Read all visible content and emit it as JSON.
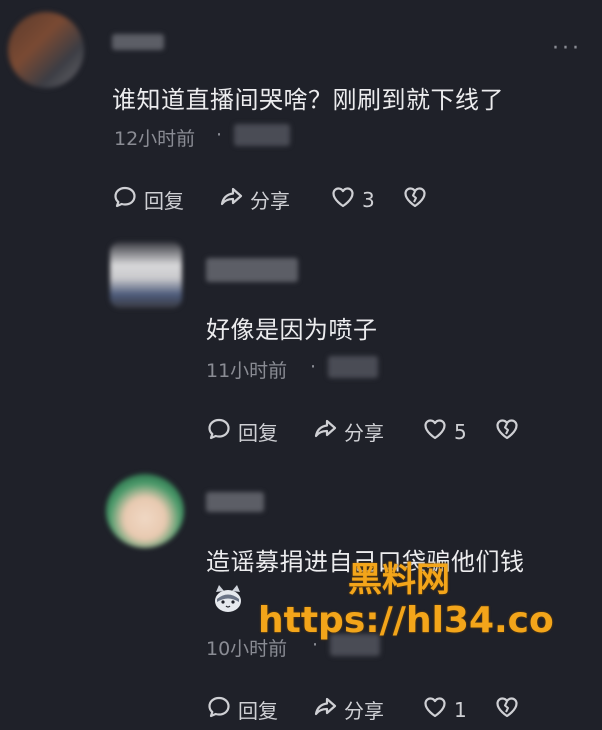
{
  "comments": [
    {
      "text": "谁知道直播间哭啥？刚刷到就下线了",
      "time": "12小时前",
      "sep": "·",
      "actions": {
        "reply": "回复",
        "share": "分享",
        "likes": "3"
      }
    },
    {
      "text": "好像是因为喷子",
      "time": "11小时前",
      "sep": "·",
      "actions": {
        "reply": "回复",
        "share": "分享",
        "likes": "5"
      }
    },
    {
      "text": "造谣募捐进自己口袋骗他们钱",
      "time": "10小时前",
      "sep": "·",
      "actions": {
        "reply": "回复",
        "share": "分享",
        "likes": "1"
      }
    }
  ],
  "more_glyph": "···",
  "watermark": {
    "line1": "黑料网",
    "line2": "https://hl34.co"
  },
  "colors": {
    "background": "#1f2129",
    "watermark": "#f3a51a",
    "muted": "#8a8c94"
  }
}
